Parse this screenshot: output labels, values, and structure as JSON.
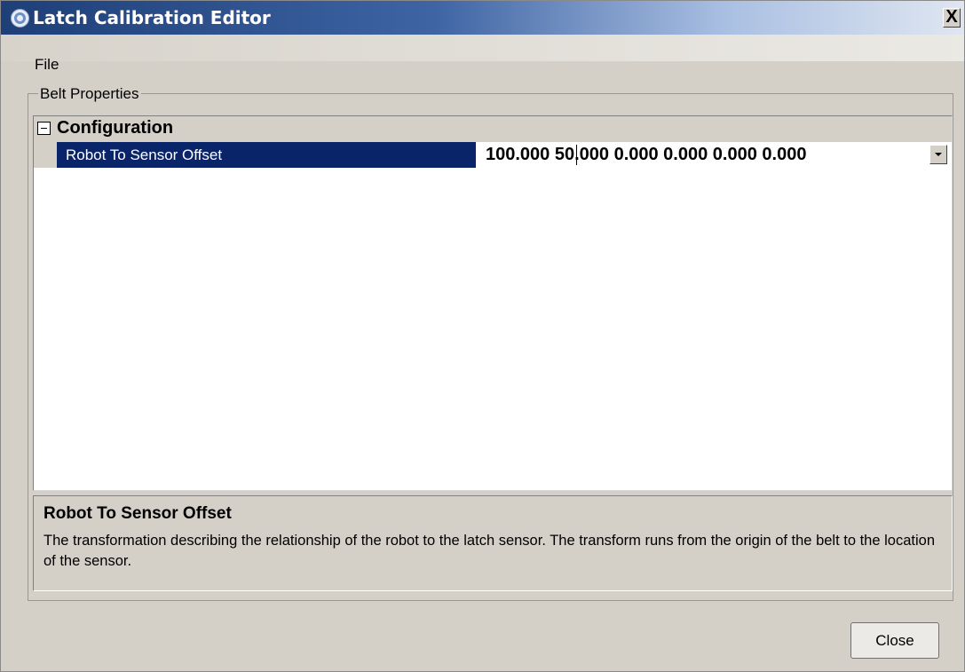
{
  "window": {
    "title": "Latch Calibration Editor",
    "close_glyph": "X",
    "app_icon": "app-logo-icon"
  },
  "menubar": {
    "file": "File"
  },
  "group": {
    "label": "Belt Properties"
  },
  "grid": {
    "category": {
      "label": "Configuration",
      "expanded": true
    },
    "properties": [
      {
        "name": "Robot To Sensor Offset",
        "value": "100.000 50.000 0.000 0.000 0.000 0.000",
        "selected": true
      }
    ]
  },
  "help": {
    "title": "Robot To Sensor Offset",
    "description": "The transformation describing the relationship of the robot to the latch sensor. The transform runs from the origin of the belt to the location of the sensor."
  },
  "buttons": {
    "close": "Close"
  },
  "colors": {
    "selection": "#0a246a",
    "face": "#d4d0c8",
    "title_dark": "#1e3f78"
  }
}
